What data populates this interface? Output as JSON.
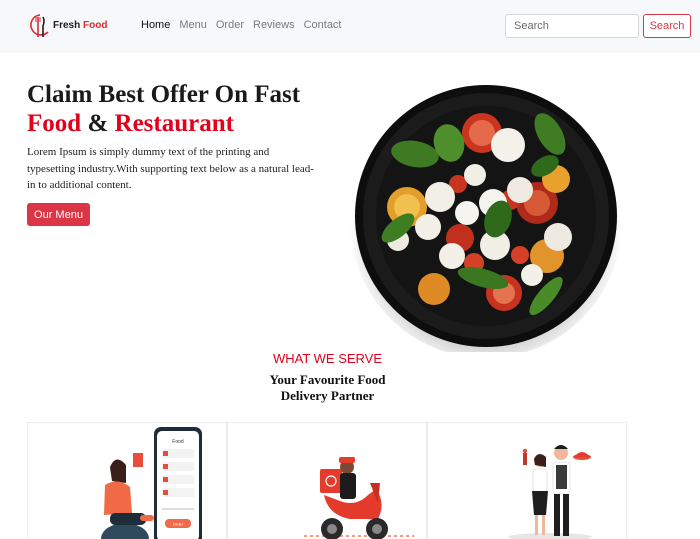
{
  "colors": {
    "accent": "#dc3545",
    "brand_red": "#e2001a",
    "navbar_bg": "#f7f8f9",
    "text_dark": "#1a1a1a"
  },
  "navbar": {
    "brand_part1": "Fresh",
    "brand_part2": "Food",
    "brand_icon": "fork-knife-logo-icon",
    "links": [
      {
        "label": "Home",
        "active": true
      },
      {
        "label": "Menu",
        "active": false
      },
      {
        "label": "Order",
        "active": false
      },
      {
        "label": "Reviews",
        "active": false
      },
      {
        "label": "Contact",
        "active": false
      }
    ],
    "search_placeholder": "Search",
    "search_value": "",
    "search_button": "Search"
  },
  "hero": {
    "title_line1": "Claim Best Offer On Fast",
    "title_word1": "Food",
    "title_amp": "&",
    "title_word2": "Restaurant",
    "description": "Lorem Ipsum is simply dummy text of the printing and typesetting industry.With supporting text below as a natural lead-in to additional content.",
    "button_label": "Our Menu",
    "image": "salad-plate-image"
  },
  "section": {
    "kicker": "WHAT WE SERVE",
    "title_line1": "Your Favourite Food",
    "title_line2": "Delivery Partner",
    "cards": [
      {
        "illustration": "phone-order-illustration",
        "phone_header": "Food",
        "phone_button": "Order"
      },
      {
        "illustration": "scooter-delivery-illustration"
      },
      {
        "illustration": "waiters-serving-illustration"
      }
    ]
  }
}
